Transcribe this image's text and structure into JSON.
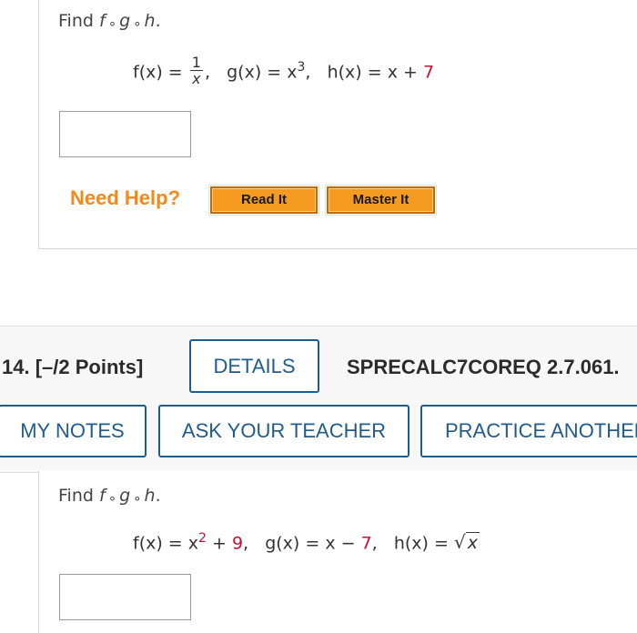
{
  "q13": {
    "prompt_find": "Find",
    "f": "f",
    "ring": "∘",
    "g": "g",
    "h": "h",
    "period": ".",
    "formula": {
      "f_lhs": "f(x) = ",
      "f_num": "1",
      "f_den": "x",
      "comma1": ",",
      "g_part": "g(x) = x",
      "g_exp": "3",
      "comma2": ",",
      "h_part": "h(x) = x + ",
      "h_const": "7"
    },
    "need_help": "Need Help?",
    "read_it": "Read It",
    "master_it": "Master It"
  },
  "q14": {
    "number_points": "14.  [–/2 Points]",
    "details": "DETAILS",
    "code": "SPRECALC7COREQ 2.7.061.",
    "my_notes": "MY NOTES",
    "ask_teacher": "ASK YOUR TEACHER",
    "practice": "PRACTICE ANOTHER",
    "prompt_find": "Find",
    "f": "f",
    "ring": "∘",
    "g": "g",
    "h": "h",
    "period": ".",
    "formula": {
      "f_lhs": "f(x) = x",
      "f_exp": "2",
      "f_plus": " + ",
      "f_const": "9",
      "comma1": ",",
      "g_part": "g(x) = x − ",
      "g_const": "7",
      "comma2": ",",
      "h_part": "h(x) = ",
      "sqrt_sign": "√",
      "sqrt_var": "x"
    }
  },
  "colors": {
    "accent_blue": "#1f5b8c",
    "help_orange": "#f08a1c",
    "button_orange": "#f59b22",
    "constant_red": "#c8102e"
  }
}
